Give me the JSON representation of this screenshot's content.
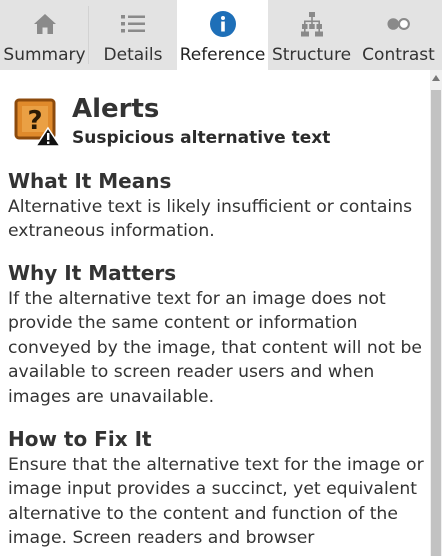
{
  "tabs": [
    {
      "label": "Summary",
      "icon": "home-icon",
      "active": false
    },
    {
      "label": "Details",
      "icon": "list-icon",
      "active": false
    },
    {
      "label": "Reference",
      "icon": "info-icon",
      "active": true
    },
    {
      "label": "Structure",
      "icon": "hierarchy-icon",
      "active": false
    },
    {
      "label": "Contrast",
      "icon": "contrast-toggle-icon",
      "active": false
    }
  ],
  "colors": {
    "tab_bar_bg": "#e3e3e3",
    "active_tab_bg": "#ffffff",
    "info_icon": "#1e6fb8",
    "inactive_icon": "#8a8a8a",
    "alert_icon_fill": "#e08a2b",
    "alert_icon_border": "#8c4a0c"
  },
  "header": {
    "category": "Alerts",
    "item_title": "Suspicious alternative text",
    "icon": "alert-question-icon"
  },
  "sections": {
    "what": {
      "heading": "What It Means",
      "body": "Alternative text is likely insufficient or contains extraneous information."
    },
    "why": {
      "heading": "Why It Matters",
      "body": "If the alternative text for an image does not provide the same content or information conveyed by the image, that content will not be available to screen reader users and when images are unavailable."
    },
    "how": {
      "heading": "How to Fix It",
      "body": "Ensure that the alternative text for the image or image input provides a succinct, yet equivalent alternative to the content and function of the image. Screen readers and browser"
    }
  }
}
